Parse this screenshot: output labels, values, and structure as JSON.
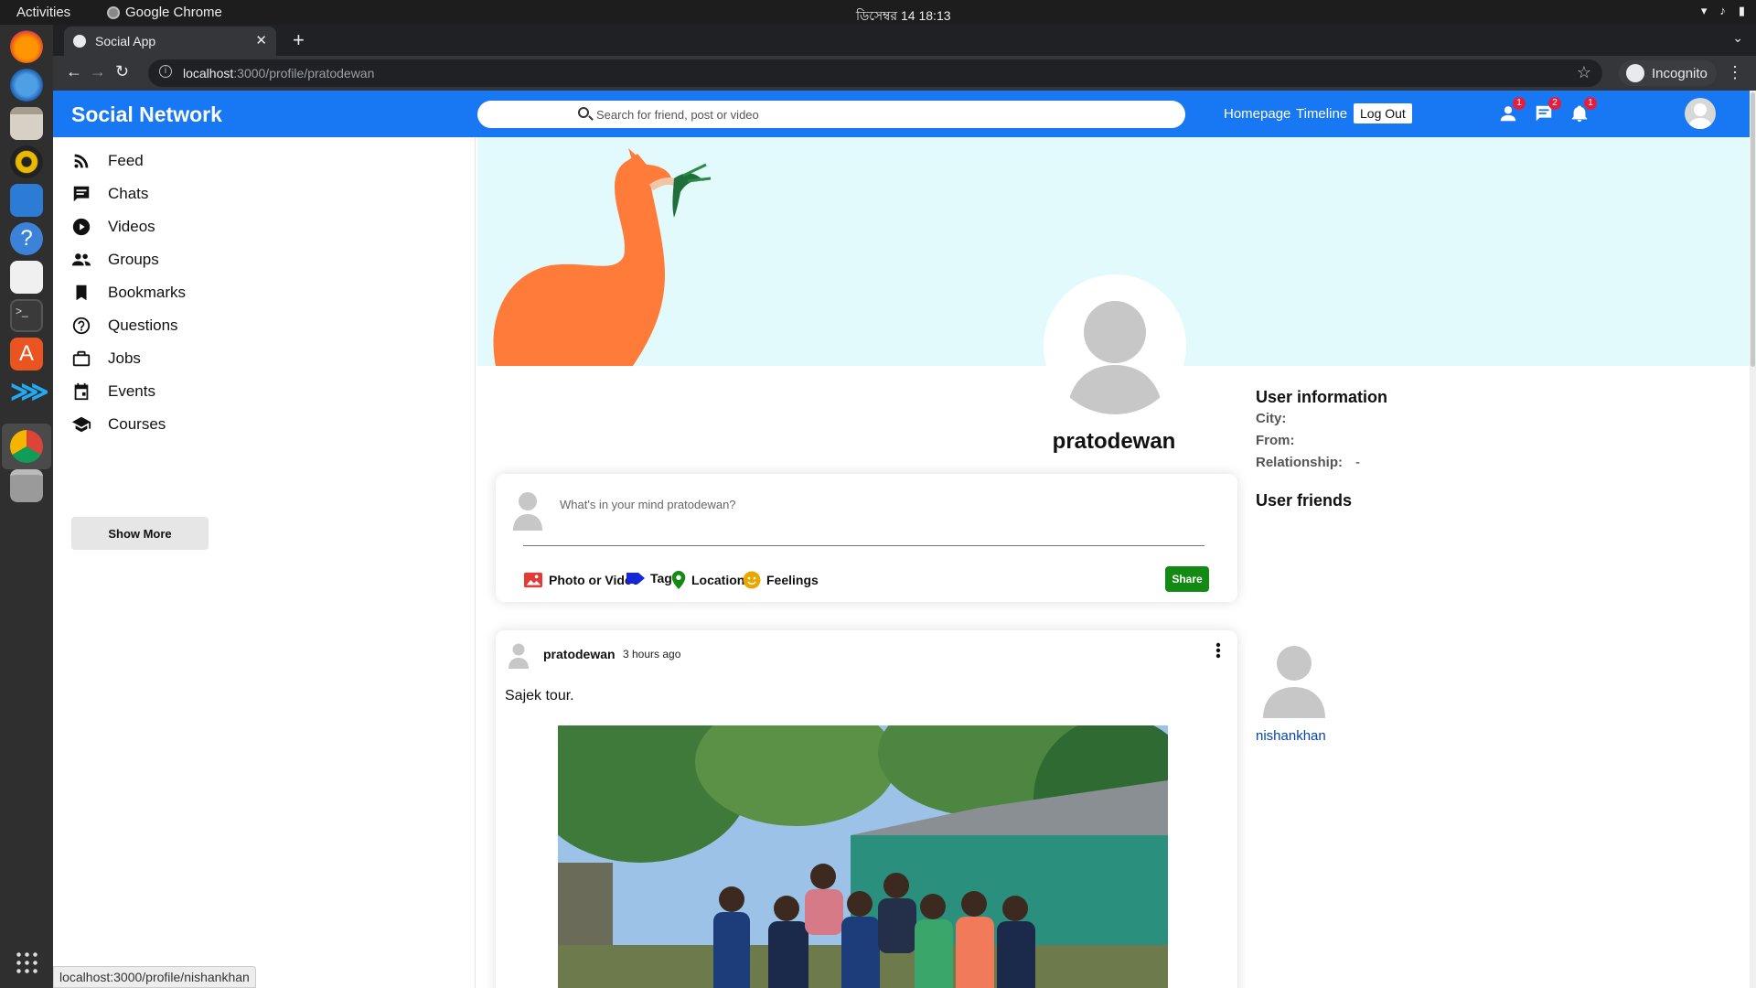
{
  "os": {
    "activities": "Activities",
    "app_name": "Google Chrome",
    "clock": "ডিসেম্বর 14  18:13"
  },
  "browser": {
    "tab_title": "Social App",
    "url_host": "localhost",
    "url_path": ":3000/profile/pratodewan",
    "profile_label": "Incognito",
    "status_url": "localhost:3000/profile/nishankhan"
  },
  "topbar": {
    "brand": "Social Network",
    "search_placeholder": "Search for friend, post or video",
    "links": [
      "Homepage",
      "Timeline"
    ],
    "logout": "Log Out",
    "badges": {
      "friends": "1",
      "messages": "2",
      "notifications": "1"
    }
  },
  "sidebar": {
    "items": [
      {
        "label": "Feed",
        "icon": "rss-icon"
      },
      {
        "label": "Chats",
        "icon": "chat-icon"
      },
      {
        "label": "Videos",
        "icon": "play-circle-icon"
      },
      {
        "label": "Groups",
        "icon": "group-icon"
      },
      {
        "label": "Bookmarks",
        "icon": "bookmark-icon"
      },
      {
        "label": "Questions",
        "icon": "help-circle-icon"
      },
      {
        "label": "Jobs",
        "icon": "briefcase-icon"
      },
      {
        "label": "Events",
        "icon": "calendar-icon"
      },
      {
        "label": "Courses",
        "icon": "school-icon"
      }
    ],
    "show_more": "Show More"
  },
  "profile": {
    "username": "pratodewan"
  },
  "share": {
    "placeholder": "What's in your mind pratodewan?",
    "options": [
      "Photo or Video",
      "Tag",
      "Location",
      "Feelings"
    ],
    "share_button": "Share"
  },
  "post": {
    "username": "pratodewan",
    "time": "3 hours ago",
    "text": "Sajek tour."
  },
  "rightbar": {
    "info_title": "User information",
    "city_label": "City:",
    "city_value": "",
    "from_label": "From:",
    "from_value": "",
    "relationship_label": "Relationship:",
    "relationship_value": "-",
    "friends_title": "User friends",
    "friends": [
      "nishankhan"
    ]
  },
  "colors": {
    "brand_blue": "#1877f2",
    "share_green": "#138a13",
    "badge_red": "#e41e3f",
    "cover_bg": "#e3fafc",
    "llama": "#ff7b3a"
  }
}
